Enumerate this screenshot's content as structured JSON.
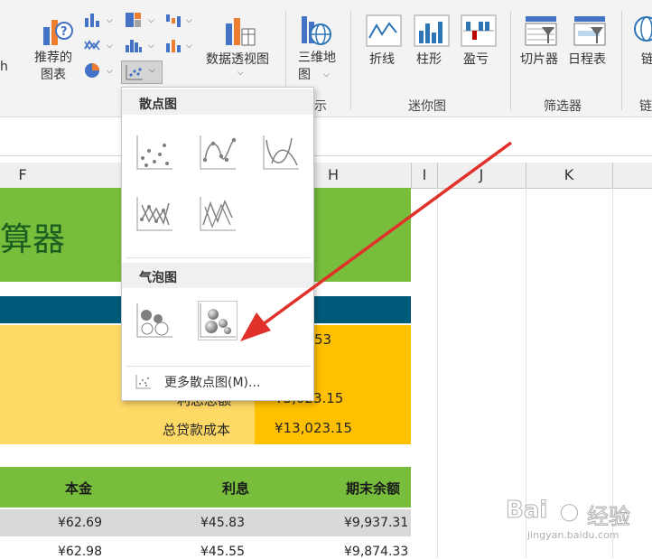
{
  "ribbon": {
    "recommended_charts": "推荐的\n图表",
    "pivot_chart": "数据透视图",
    "map_3d": "三维地\n图",
    "sparkline_line": "折线",
    "sparkline_column": "柱形",
    "sparkline_winloss": "盈亏",
    "slicer": "切片器",
    "timeline": "日程表",
    "link_partial": "链",
    "left_edge_partial": "h",
    "groups": {
      "tours_partial": "示",
      "sparklines": "迷你图",
      "filters": "筛选器",
      "links_partial": "链"
    }
  },
  "sheet": {
    "columns": [
      "F",
      "H",
      "I",
      "J",
      "K"
    ],
    "title_partial": "算器",
    "summary": {
      "value1_partial": "53",
      "interest_label_partial": "利息总额",
      "interest_value_partial": "¥3,023.15",
      "total_cost_label": "总贷款成本",
      "total_cost_value": "¥13,023.15"
    },
    "table": {
      "headers": [
        "本金",
        "利息",
        "期末余额"
      ],
      "rows": [
        [
          "¥62.69",
          "¥45.83",
          "¥9,937.31"
        ],
        [
          "¥62.98",
          "¥45.55",
          "¥9,874.33"
        ]
      ]
    }
  },
  "menu": {
    "scatter_title": "散点图",
    "bubble_title": "气泡图",
    "more_label": "更多散点图(M)..."
  },
  "watermark": {
    "brand": "Bai",
    "brand_suffix": "经验",
    "url": "jingyan.baidu.com"
  },
  "colors": {
    "green": "#78be3c",
    "teal": "#005a7a",
    "light_yellow": "#ffd966",
    "gold": "#ffc000",
    "arrow": "#e0312a"
  }
}
